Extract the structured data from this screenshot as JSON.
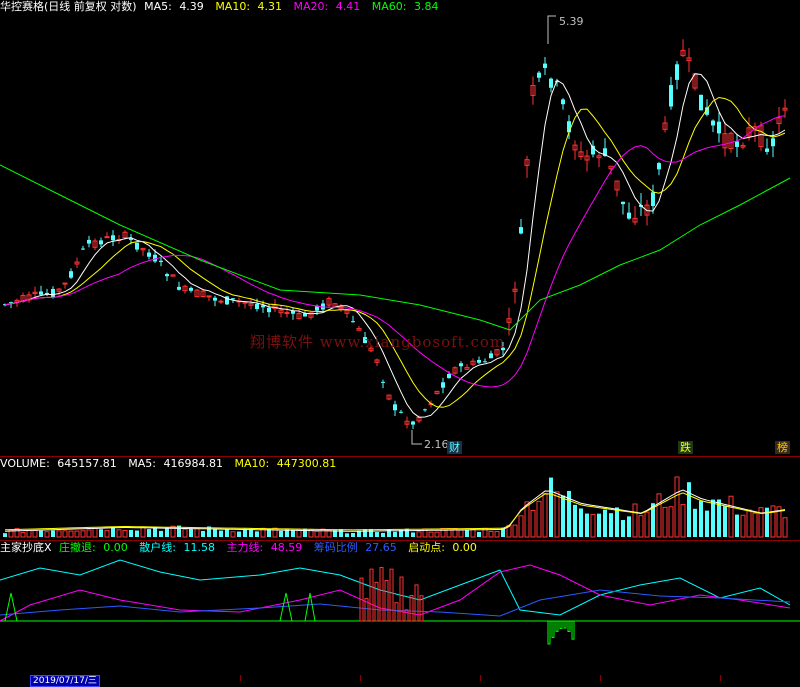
{
  "main": {
    "title": "华控赛格(日线 前复权 对数)",
    "ma5_label": "MA5:",
    "ma5_value": "4.39",
    "ma10_label": "MA10:",
    "ma10_value": "4.31",
    "ma20_label": "MA20:",
    "ma20_value": "4.41",
    "ma60_label": "MA60:",
    "ma60_value": "3.84",
    "high_label": "5.39",
    "low_label": "2.16",
    "markers": [
      "财",
      "跌",
      "榜"
    ]
  },
  "volume": {
    "volume_label": "VOLUME:",
    "volume_value": "645157.81",
    "ma5_label": "MA5:",
    "ma5_value": "416984.81",
    "ma10_label": "MA10:",
    "ma10_value": "447300.81"
  },
  "indicator": {
    "name": "主家抄底X",
    "zhuang_label": "庄撤退:",
    "zhuang_value": "0.00",
    "sanhu_label": "散户线:",
    "sanhu_value": "11.58",
    "zhuli_label": "主力线:",
    "zhuli_value": "48.59",
    "chouma_label": "筹码比例",
    "chouma_value": "27.65",
    "qidong_label": "启动点:",
    "qidong_value": "0.00"
  },
  "watermark": "翔博软件  www.xiangbosoft.com",
  "date_box": "2019/07/17/三",
  "colors": {
    "up": "#ff3232",
    "down": "#54ffff",
    "ma5": "#ffffff",
    "ma10": "#ffff00",
    "ma20": "#ff00ff",
    "ma60": "#00ff00",
    "sanhu": "#00ffff",
    "zhuli": "#ff00ff",
    "chouma": "#2a5bff",
    "zhuang": "#00ff00"
  }
}
